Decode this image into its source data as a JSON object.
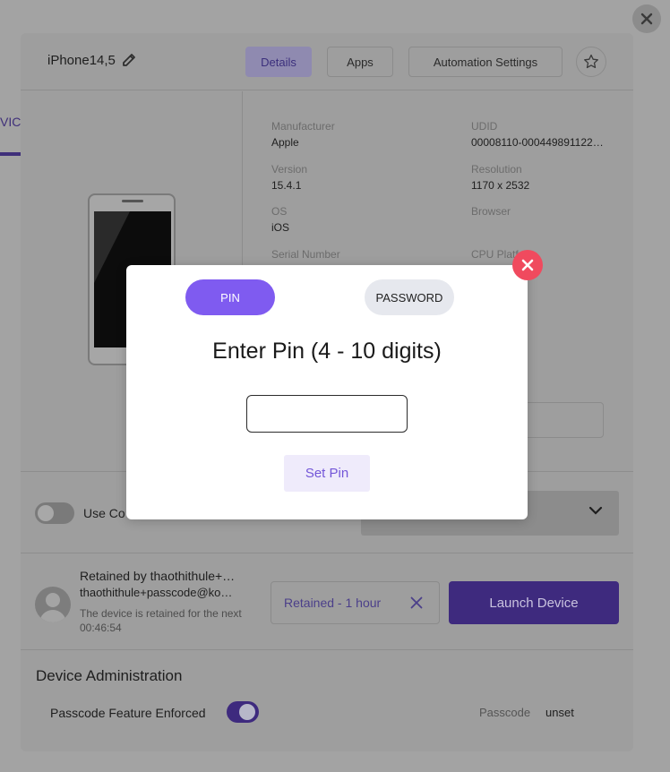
{
  "background": {
    "left_tab_fragment": "VIC"
  },
  "panel": {
    "device_name": "iPhone14,5",
    "tabs": [
      {
        "label": "Details",
        "active": true
      },
      {
        "label": "Apps",
        "active": false
      },
      {
        "label": "Automation Settings",
        "active": false
      }
    ],
    "info": {
      "manufacturer_label": "Manufacturer",
      "manufacturer_value": "Apple",
      "udid_label": "UDID",
      "udid_value": "00008110-000449891122…",
      "version_label": "Version",
      "version_value": "15.4.1",
      "resolution_label": "Resolution",
      "resolution_value": "1170 x 2532",
      "os_label": "OS",
      "os_value": "iOS",
      "browser_label": "Browser",
      "serial_label": "Serial Number",
      "cpu_label": "CPU Platform"
    },
    "use_toggle_label": "Use Co",
    "retained": {
      "title": "Retained by thaothithule+…",
      "email": "thaothithule+passcode@ko…",
      "note": "The device is retained for the next 00:46:54",
      "pill_text": "Retained - 1 hour",
      "launch_label": "Launch Device"
    },
    "admin": {
      "title": "Device Administration",
      "passcode_feature_label": "Passcode Feature Enforced",
      "passcode_enforced": true,
      "passcode_key": "Passcode",
      "passcode_value": "unset"
    }
  },
  "modal": {
    "tab_pin": "PIN",
    "tab_password": "PASSWORD",
    "title": "Enter Pin (4 - 10 digits)",
    "pin_value": "",
    "set_pin_label": "Set Pin"
  },
  "colors": {
    "accent": "#7f5bf0",
    "close_red": "#f04a5e",
    "launch_purple": "#3e2a7e"
  }
}
